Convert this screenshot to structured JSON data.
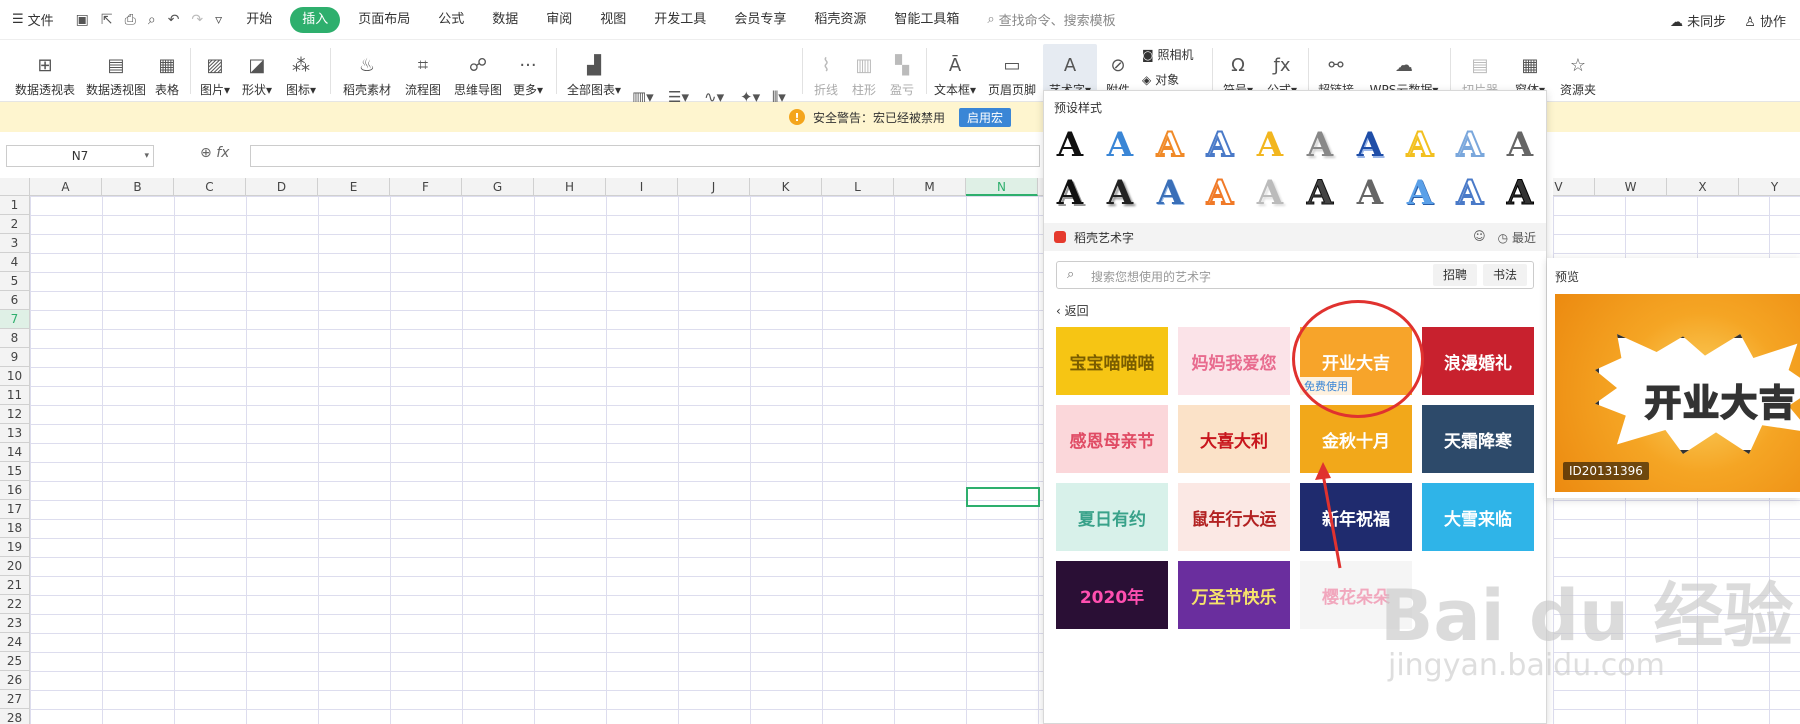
{
  "menubar": {
    "file_label": "文件",
    "tabs": [
      {
        "label": "开始",
        "active": false
      },
      {
        "label": "插入",
        "active": true
      },
      {
        "label": "页面布局",
        "active": false
      },
      {
        "label": "公式",
        "active": false
      },
      {
        "label": "数据",
        "active": false
      },
      {
        "label": "审阅",
        "active": false
      },
      {
        "label": "视图",
        "active": false
      },
      {
        "label": "开发工具",
        "active": false
      },
      {
        "label": "会员专享",
        "active": false
      },
      {
        "label": "稻壳资源",
        "active": false
      },
      {
        "label": "智能工具箱",
        "active": false
      }
    ],
    "search_placeholder": "查找命令、搜索模板",
    "sync_label": "未同步",
    "collab_label": "协作"
  },
  "ribbon": {
    "pivot_table": "数据透视表",
    "pivot_chart": "数据透视图",
    "table": "表格",
    "picture": "图片",
    "shape": "形状",
    "icon": "图标",
    "docer_material": "稻壳素材",
    "flowchart": "流程图",
    "mindmap": "思维导图",
    "more": "更多",
    "all_charts": "全部图表",
    "sparkline_line": "折线",
    "sparkline_column": "柱形",
    "sparkline_winloss": "盈亏",
    "textbox": "文本框",
    "header_footer": "页眉页脚",
    "wordart": "艺术字",
    "attachment": "附件",
    "camera": "照相机",
    "object": "对象",
    "symbol": "符号",
    "formula": "公式",
    "hyperlink": "超链接",
    "wps_cloud_data": "WPS云数据",
    "slicer": "切片器",
    "window": "窗体",
    "resource_folder": "资源夹"
  },
  "warning": {
    "text": "安全警告：宏已经被禁用",
    "button": "启用宏"
  },
  "formula_bar": {
    "name_box": "N7",
    "fx": "fx"
  },
  "grid": {
    "columns": [
      "A",
      "B",
      "C",
      "D",
      "E",
      "F",
      "G",
      "H",
      "I",
      "J",
      "K",
      "L",
      "M",
      "N"
    ],
    "right_columns": [
      "V",
      "W",
      "X",
      "Y"
    ],
    "rows": [
      "1",
      "2",
      "3",
      "4",
      "5",
      "6",
      "7",
      "8",
      "9",
      "10",
      "11",
      "12",
      "13",
      "14",
      "15",
      "16",
      "17",
      "18",
      "19",
      "20",
      "21",
      "22",
      "23",
      "24",
      "25",
      "26",
      "27",
      "28"
    ],
    "active_column": "N",
    "active_row": "7"
  },
  "panel": {
    "preset_title": "预设样式",
    "section_title": "稻壳艺术字",
    "recent_label": "最近",
    "search_placeholder": "搜索您想使用的艺术字",
    "tag_1": "招聘",
    "tag_2": "书法",
    "back_label": "返回",
    "templates": [
      {
        "text": "宝宝喵喵喵",
        "bg": "#f6c514",
        "fg": "#7a5d00"
      },
      {
        "text": "妈妈我爱您",
        "bg": "#fbe3e8",
        "fg": "#e86b8e"
      },
      {
        "text": "开业大吉",
        "bg": "#f7a42a",
        "fg": "#ffffff",
        "free": "免费使用"
      },
      {
        "text": "浪漫婚礼",
        "bg": "#c8212e",
        "fg": "#ffffff"
      },
      {
        "text": "感恩母亲节",
        "bg": "#fbd7da",
        "fg": "#e04b64"
      },
      {
        "text": "大喜大利",
        "bg": "#fbe2c8",
        "fg": "#c8161d"
      },
      {
        "text": "金秋十月",
        "bg": "#f2a81a",
        "fg": "#ffffff"
      },
      {
        "text": "天霜降寒",
        "bg": "#2d4a6a",
        "fg": "#ffffff"
      },
      {
        "text": "夏日有约",
        "bg": "#d8f1ea",
        "fg": "#39a28a"
      },
      {
        "text": "鼠年行大运",
        "bg": "#fbe8e4",
        "fg": "#b22222"
      },
      {
        "text": "新年祝福",
        "bg": "#1f2b6e",
        "fg": "#ffffff"
      },
      {
        "text": "大雪来临",
        "bg": "#2fb4e8",
        "fg": "#ffffff"
      },
      {
        "text": "2020年",
        "bg": "#2a0f35",
        "fg": "#ff4fb0"
      },
      {
        "text": "万圣节快乐",
        "bg": "#6a2e9e",
        "fg": "#f6e36b"
      },
      {
        "text": "樱花朵朵",
        "bg": "#f5f5f5",
        "fg": "#f1a7bd"
      }
    ]
  },
  "preview": {
    "title": "预览",
    "word": "开业大吉",
    "id": "ID20131396"
  },
  "watermark": {
    "text": "Bai du 经验",
    "url": "jingyan.baidu.com"
  }
}
